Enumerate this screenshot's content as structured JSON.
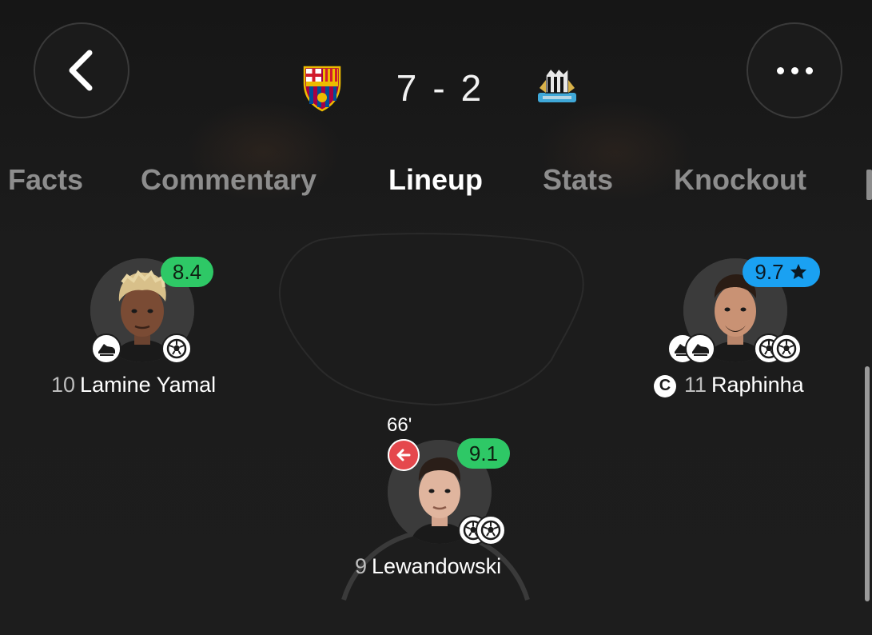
{
  "header": {
    "home_score": "7",
    "separator": "-",
    "away_score": "2"
  },
  "tabs": [
    {
      "label": "Facts"
    },
    {
      "label": "Commentary"
    },
    {
      "label": "Lineup",
      "active": true
    },
    {
      "label": "Stats"
    },
    {
      "label": "Knockout"
    }
  ],
  "players": [
    {
      "number": "10",
      "name": "Lamine Yamal",
      "rating": "8.4",
      "rating_color": "#2ec866",
      "events": [
        "assist-boot-icon",
        "goal-ball-icon"
      ]
    },
    {
      "number": "11",
      "name": "Raphinha",
      "rating": "9.7",
      "rating_color": "#1aa1f2",
      "player_of_match": true,
      "captain": "C",
      "events": [
        "assist-boot-icon",
        "assist-boot-icon",
        "goal-ball-icon",
        "goal-ball-icon"
      ]
    },
    {
      "number": "9",
      "name": "Lewandowski",
      "rating": "9.1",
      "rating_color": "#2ec866",
      "sub_minute": "66'",
      "events": [
        "goal-ball-icon",
        "goal-ball-icon"
      ]
    }
  ],
  "colors": {
    "background": "#1b1b1b",
    "tab_inactive": "#8d8d8d",
    "rating_green": "#2ec866",
    "rating_blue": "#1aa1f2",
    "sub_out_red": "#e5484d"
  }
}
